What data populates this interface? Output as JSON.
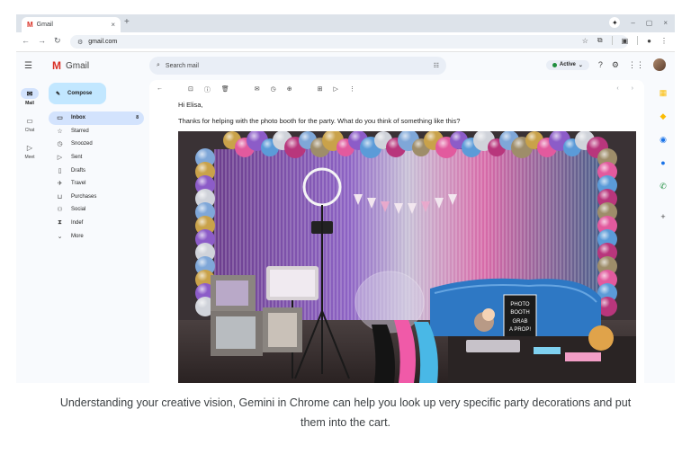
{
  "browser": {
    "tab_title": "Gmail",
    "tab_close": "×",
    "new_tab": "+",
    "url": "gmail.com",
    "window_controls": {
      "gemini": "✦",
      "minimize": "–",
      "restore": "▢",
      "close": "×"
    }
  },
  "gmail": {
    "product_name": "Gmail",
    "search_placeholder": "Search mail",
    "status": "Active",
    "rail": [
      {
        "label": "Mail",
        "icon": "mail-icon"
      },
      {
        "label": "Chat",
        "icon": "chat-icon"
      },
      {
        "label": "Meet",
        "icon": "meet-icon"
      }
    ],
    "compose_label": "Compose",
    "folders": [
      {
        "label": "Inbox",
        "icon": "inbox-icon",
        "count": "8"
      },
      {
        "label": "Starred",
        "icon": "star-icon",
        "count": ""
      },
      {
        "label": "Snoozed",
        "icon": "clock-icon",
        "count": ""
      },
      {
        "label": "Sent",
        "icon": "send-icon",
        "count": ""
      },
      {
        "label": "Drafts",
        "icon": "draft-icon",
        "count": ""
      },
      {
        "label": "Travel",
        "icon": "plane-icon",
        "count": ""
      },
      {
        "label": "Purchases",
        "icon": "cart-icon",
        "count": ""
      },
      {
        "label": "Social",
        "icon": "people-icon",
        "count": ""
      },
      {
        "label": "Indef",
        "icon": "hourglass-icon",
        "count": ""
      },
      {
        "label": "More",
        "icon": "chevron-down-icon",
        "count": ""
      }
    ]
  },
  "email": {
    "greeting": "Hi Elisa,",
    "body": "Thanks for helping with the photo booth for the party. What do you think of something like this?",
    "photo_sign": [
      "PHOTO",
      "BOOTH",
      "GRAB",
      "A PROP!"
    ]
  },
  "caption": {
    "line1": "Understanding your creative vision, Gemini in Chrome can help you look up very specific party decorations and put",
    "line2": "them into the cart."
  }
}
